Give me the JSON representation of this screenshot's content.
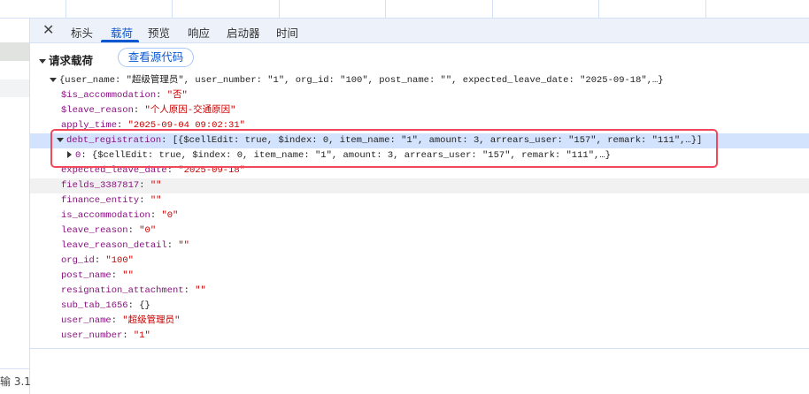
{
  "tabs": {
    "close_icon": "close-icon",
    "items": [
      {
        "label": "标头"
      },
      {
        "label": "载荷"
      },
      {
        "label": "预览"
      },
      {
        "label": "响应"
      },
      {
        "label": "启动器"
      },
      {
        "label": "时间"
      }
    ],
    "active": "载荷"
  },
  "payload": {
    "section_title": "请求载荷",
    "view_source_label": "查看源代码",
    "root_summary": "{user_name: \"超级管理员\", user_number: \"1\", org_id: \"100\", post_name: \"\", expected_leave_date: \"2025-09-18\",…}",
    "rows": [
      {
        "key": "$is_accommodation",
        "value": "\"否\""
      },
      {
        "key": "$leave_reason",
        "value": "\"个人原因-交通原因\""
      },
      {
        "key": "apply_time",
        "value": "\"2025-09-04 09:02:31\""
      },
      {
        "key": "debt_registration",
        "value": "[{$cellEdit: true, $index: 0, item_name: \"1\", amount: 3, arrears_user: \"157\", remark: \"111\",…}]"
      },
      {
        "key": "0",
        "value": "{$cellEdit: true, $index: 0, item_name: \"1\", amount: 3, arrears_user: \"157\", remark: \"111\",…}"
      },
      {
        "key": "expected_leave_date",
        "value": "\"2025-09-18\""
      },
      {
        "key": "fields_3387817",
        "value": "\"\""
      },
      {
        "key": "finance_entity",
        "value": "\"\""
      },
      {
        "key": "is_accommodation",
        "value": "\"0\""
      },
      {
        "key": "leave_reason",
        "value": "\"0\""
      },
      {
        "key": "leave_reason_detail",
        "value": "\"\""
      },
      {
        "key": "org_id",
        "value": "\"100\""
      },
      {
        "key": "post_name",
        "value": "\"\""
      },
      {
        "key": "resignation_attachment",
        "value": "\"\""
      },
      {
        "key": "sub_tab_1656",
        "value": "{}"
      },
      {
        "key": "user_name",
        "value": "\"超级管理员\""
      },
      {
        "key": "user_number",
        "value": "\"1\""
      }
    ]
  },
  "left_panel": {
    "status_text": "输 3.1"
  },
  "colors": {
    "accent": "#0b57d0",
    "highlight": "#d3e3fd",
    "annotation_box": "#f1495b",
    "key": "#881280",
    "string": "#c80000"
  }
}
